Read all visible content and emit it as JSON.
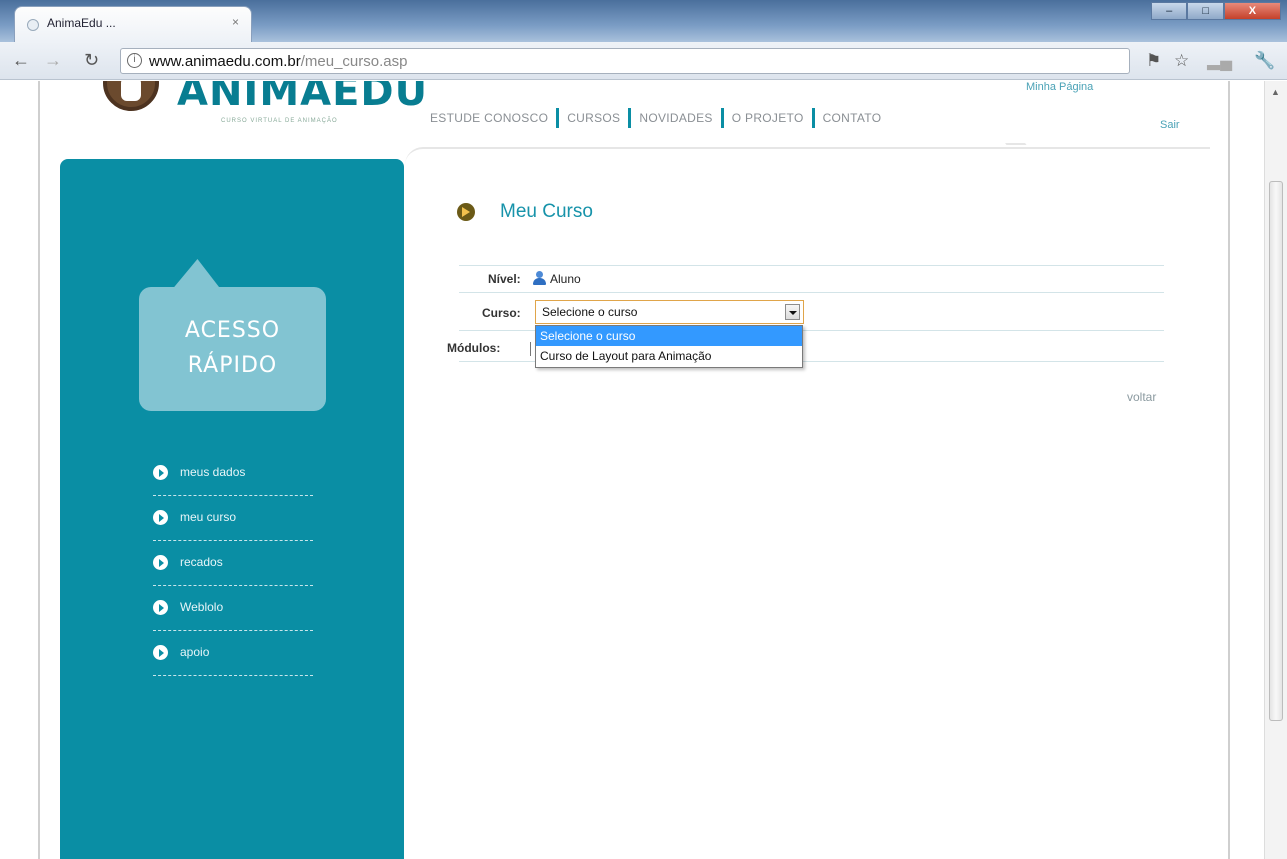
{
  "browser": {
    "tab_title": "AnimaEdu ...",
    "tab_close": "×",
    "url_host": "www.animaedu.com.br",
    "url_path": "/meu_curso.asp",
    "controls": {
      "minimize": "–",
      "maximize": "□",
      "close": "X"
    }
  },
  "header": {
    "logo_text": "ANIMAEDU",
    "logo_subtitle": "CURSO VIRTUAL DE ANIMAÇÃO",
    "nav": [
      "ESTUDE CONOSCO",
      "CURSOS",
      "NOVIDADES",
      "O PROJETO",
      "CONTATO"
    ],
    "minha_pagina": "Minha Página",
    "sair": "Sair"
  },
  "sidebar": {
    "bubble_line1": "ACESSO",
    "bubble_line2": "RÁPIDO",
    "items": [
      {
        "label": "meus dados"
      },
      {
        "label": "meu curso"
      },
      {
        "label": "recados"
      },
      {
        "label": "Weblolo"
      },
      {
        "label": "apoio"
      }
    ]
  },
  "main": {
    "title": "Meu Curso",
    "nivel_label": "Nível:",
    "nivel_value": "Aluno",
    "curso_label": "Curso:",
    "curso_selected": "Selecione o curso",
    "curso_options": [
      "Selecione o curso",
      "Curso de Layout para Animação"
    ],
    "modulos_label": "Módulos:",
    "voltar": "voltar"
  },
  "colors": {
    "brand_teal": "#0a8ea4",
    "bubble": "#82c4d2",
    "title": "#1793aa",
    "select_highlight": "#3399ff"
  }
}
